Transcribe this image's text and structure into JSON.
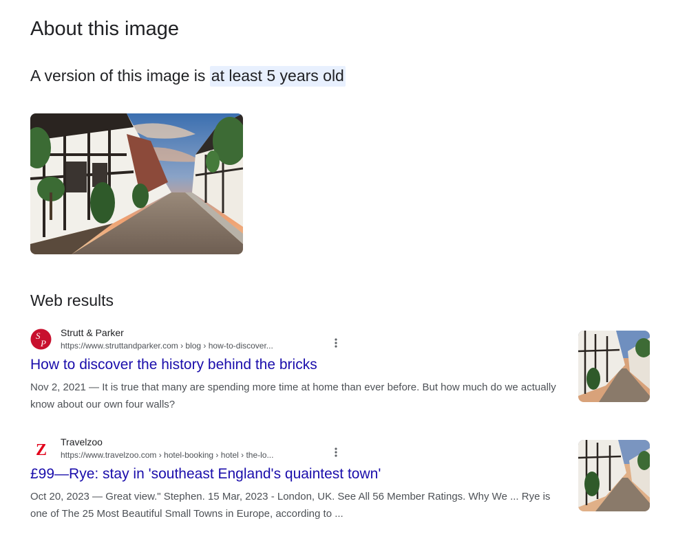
{
  "page": {
    "title": "About this image",
    "age_prefix": "A version of this image is ",
    "age_highlight": "at least 5 years old"
  },
  "web_results": {
    "heading": "Web results",
    "items": [
      {
        "site_name": "Strutt & Parker",
        "url": "https://www.struttandparker.com › blog › how-to-discover...",
        "title": "How to discover the history behind the bricks",
        "snippet": "Nov 2, 2021 — It is true that many are spending more time at home than ever before. But how much do we actually know about our own four walls?",
        "favicon_text": "SP",
        "favicon_color": "#c8102e"
      },
      {
        "site_name": "Travelzoo",
        "url": "https://www.travelzoo.com › hotel-booking › hotel › the-lo...",
        "title": "£99—Rye: stay in 'southeast England's quaintest town'",
        "snippet": "Oct 20, 2023 — Great view.\" Stephen. 15 Mar, 2023 - London, UK. See All 56 Member Ratings. Why We ... Rye is one of The 25 Most Beautiful Small Towns in Europe, according to ...",
        "favicon_text": "Z",
        "favicon_color": "#e2001a"
      }
    ]
  },
  "colors": {
    "link": "#1a0dab",
    "highlight": "#e8f0fe",
    "text": "#202124",
    "muted": "#4d5156"
  }
}
